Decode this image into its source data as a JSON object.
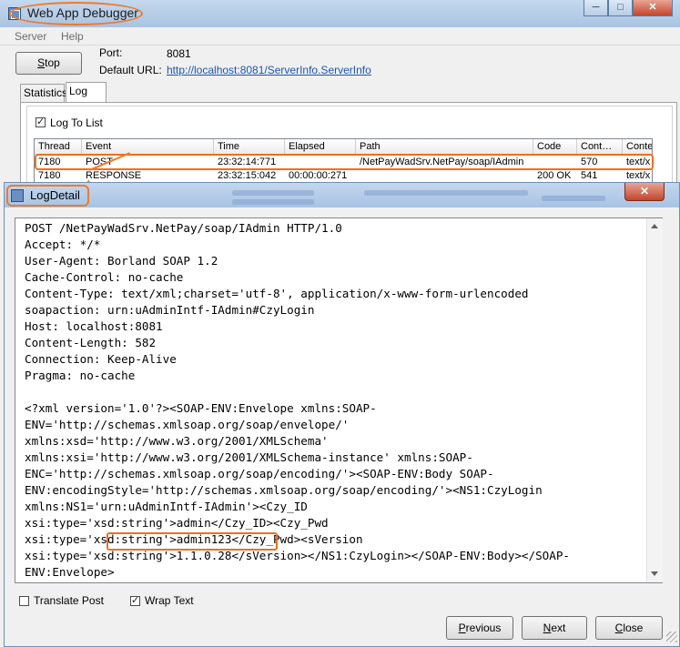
{
  "app": {
    "title": "Web App Debugger",
    "caption_min": "─",
    "caption_max": "□",
    "caption_close": "✕"
  },
  "menu": [
    "Server",
    "Help"
  ],
  "server": {
    "stop_label_u": "S",
    "stop_label_rest": "top",
    "port_label": "Port:",
    "port_value": "8081",
    "url_label": "Default URL:",
    "url_value": "http://localhost:8081/ServerInfo.ServerInfo"
  },
  "tabs": [
    {
      "label": "Statistics",
      "active": false
    },
    {
      "label": "Log",
      "active": true
    }
  ],
  "log": {
    "log_to_list_label": "Log To List",
    "log_to_list_checked": true,
    "columns": [
      "Thread",
      "Event",
      "Time",
      "Elapsed",
      "Path",
      "Code",
      "Cont…",
      "Conte"
    ],
    "rows": [
      [
        "7180",
        "POST",
        "23:32:14:771",
        "",
        "/NetPayWadSrv.NetPay/soap/IAdmin",
        "",
        "570",
        "text/x"
      ],
      [
        "7180",
        "RESPONSE",
        "23:32:15:042",
        "00:00:00:271",
        "",
        "200 OK",
        "541",
        "text/x"
      ]
    ]
  },
  "detail": {
    "title": "LogDetail",
    "close_glyph": "✕",
    "content": "POST /NetPayWadSrv.NetPay/soap/IAdmin HTTP/1.0\nAccept: */*\nUser-Agent: Borland SOAP 1.2\nCache-Control: no-cache\nContent-Type: text/xml;charset='utf-8', application/x-www-form-urlencoded\nsoapaction: urn:uAdminIntf-IAdmin#CzyLogin\nHost: localhost:8081\nContent-Length: 582\nConnection: Keep-Alive\nPragma: no-cache\n\n<?xml version='1.0'?><SOAP-ENV:Envelope xmlns:SOAP-\nENV='http://schemas.xmlsoap.org/soap/envelope/'\nxmlns:xsd='http://www.w3.org/2001/XMLSchema'\nxmlns:xsi='http://www.w3.org/2001/XMLSchema-instance' xmlns:SOAP-\nENC='http://schemas.xmlsoap.org/soap/encoding/'><SOAP-ENV:Body SOAP-\nENV:encodingStyle='http://schemas.xmlsoap.org/soap/encoding/'><NS1:CzyLogin\nxmlns:NS1='urn:uAdminIntf-IAdmin'><Czy_ID\nxsi:type='xsd:string'>admin</Czy_ID><Czy_Pwd\nxsi:type='xsd:string'>admin123</Czy_Pwd><sVersion\nxsi:type='xsd:string'>1.1.0.28</sVersion></NS1:CzyLogin></SOAP-ENV:Body></SOAP-\nENV:Envelope>",
    "translate_post_label": "Translate Post",
    "translate_post_checked": false,
    "wrap_text_label": "Wrap Text",
    "wrap_text_checked": true,
    "previous_u": "P",
    "previous_rest": "revious",
    "next_u": "N",
    "next_rest": "ext",
    "close_u": "C",
    "close_rest": "lose"
  },
  "colors": {
    "highlight": "#ef6f1f",
    "link": "#1a55b0"
  }
}
